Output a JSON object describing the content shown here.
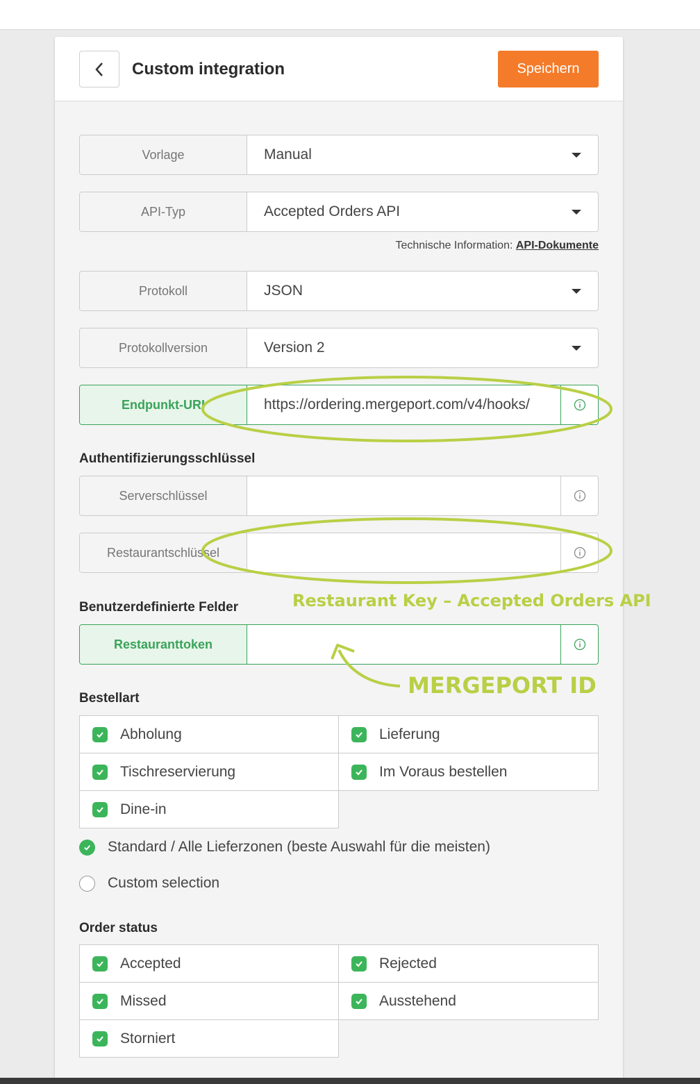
{
  "header": {
    "title": "Custom integration",
    "save_label": "Speichern"
  },
  "fields": {
    "vorlage": {
      "label": "Vorlage",
      "value": "Manual"
    },
    "api_typ": {
      "label": "API-Typ",
      "value": "Accepted Orders API"
    },
    "tech_info": {
      "prefix": "Technische Information:",
      "link": "API-Dokumente"
    },
    "protokoll": {
      "label": "Protokoll",
      "value": "JSON"
    },
    "protokollversion": {
      "label": "Protokollversion",
      "value": "Version 2"
    },
    "endpunkt": {
      "label": "Endpunkt-URI",
      "value": "https://ordering.mergeport.com/v4/hooks/"
    }
  },
  "auth": {
    "heading": "Authentifizierungsschlüssel",
    "server_key": {
      "label": "Serverschlüssel",
      "value": ""
    },
    "restaurant_key": {
      "label": "Restaurantschlüssel",
      "value": ""
    }
  },
  "custom_fields": {
    "heading": "Benutzerdefinierte Felder",
    "token": {
      "label": "Restauranttoken",
      "value": ""
    }
  },
  "annotations": {
    "restaurant_key_note": "Restaurant Key – Accepted Orders API",
    "mergeport_id_note": "MERGEPORT ID",
    "highlight_color": "#b9cf45"
  },
  "order_type": {
    "heading": "Bestellart",
    "options": [
      "Abholung",
      "Lieferung",
      "Tischreservierung",
      "Im Voraus bestellen",
      "Dine-in"
    ]
  },
  "delivery_zones": {
    "standard": "Standard / Alle Lieferzonen (beste Auswahl für die meisten)",
    "custom": "Custom selection",
    "selected": "standard"
  },
  "order_status": {
    "heading": "Order status",
    "options": [
      "Accepted",
      "Rejected",
      "Missed",
      "Ausstehend",
      "Storniert"
    ]
  },
  "colors": {
    "accent": "#f47b2a",
    "check": "#3cb55a",
    "highlight_green": "#3aa35a"
  }
}
